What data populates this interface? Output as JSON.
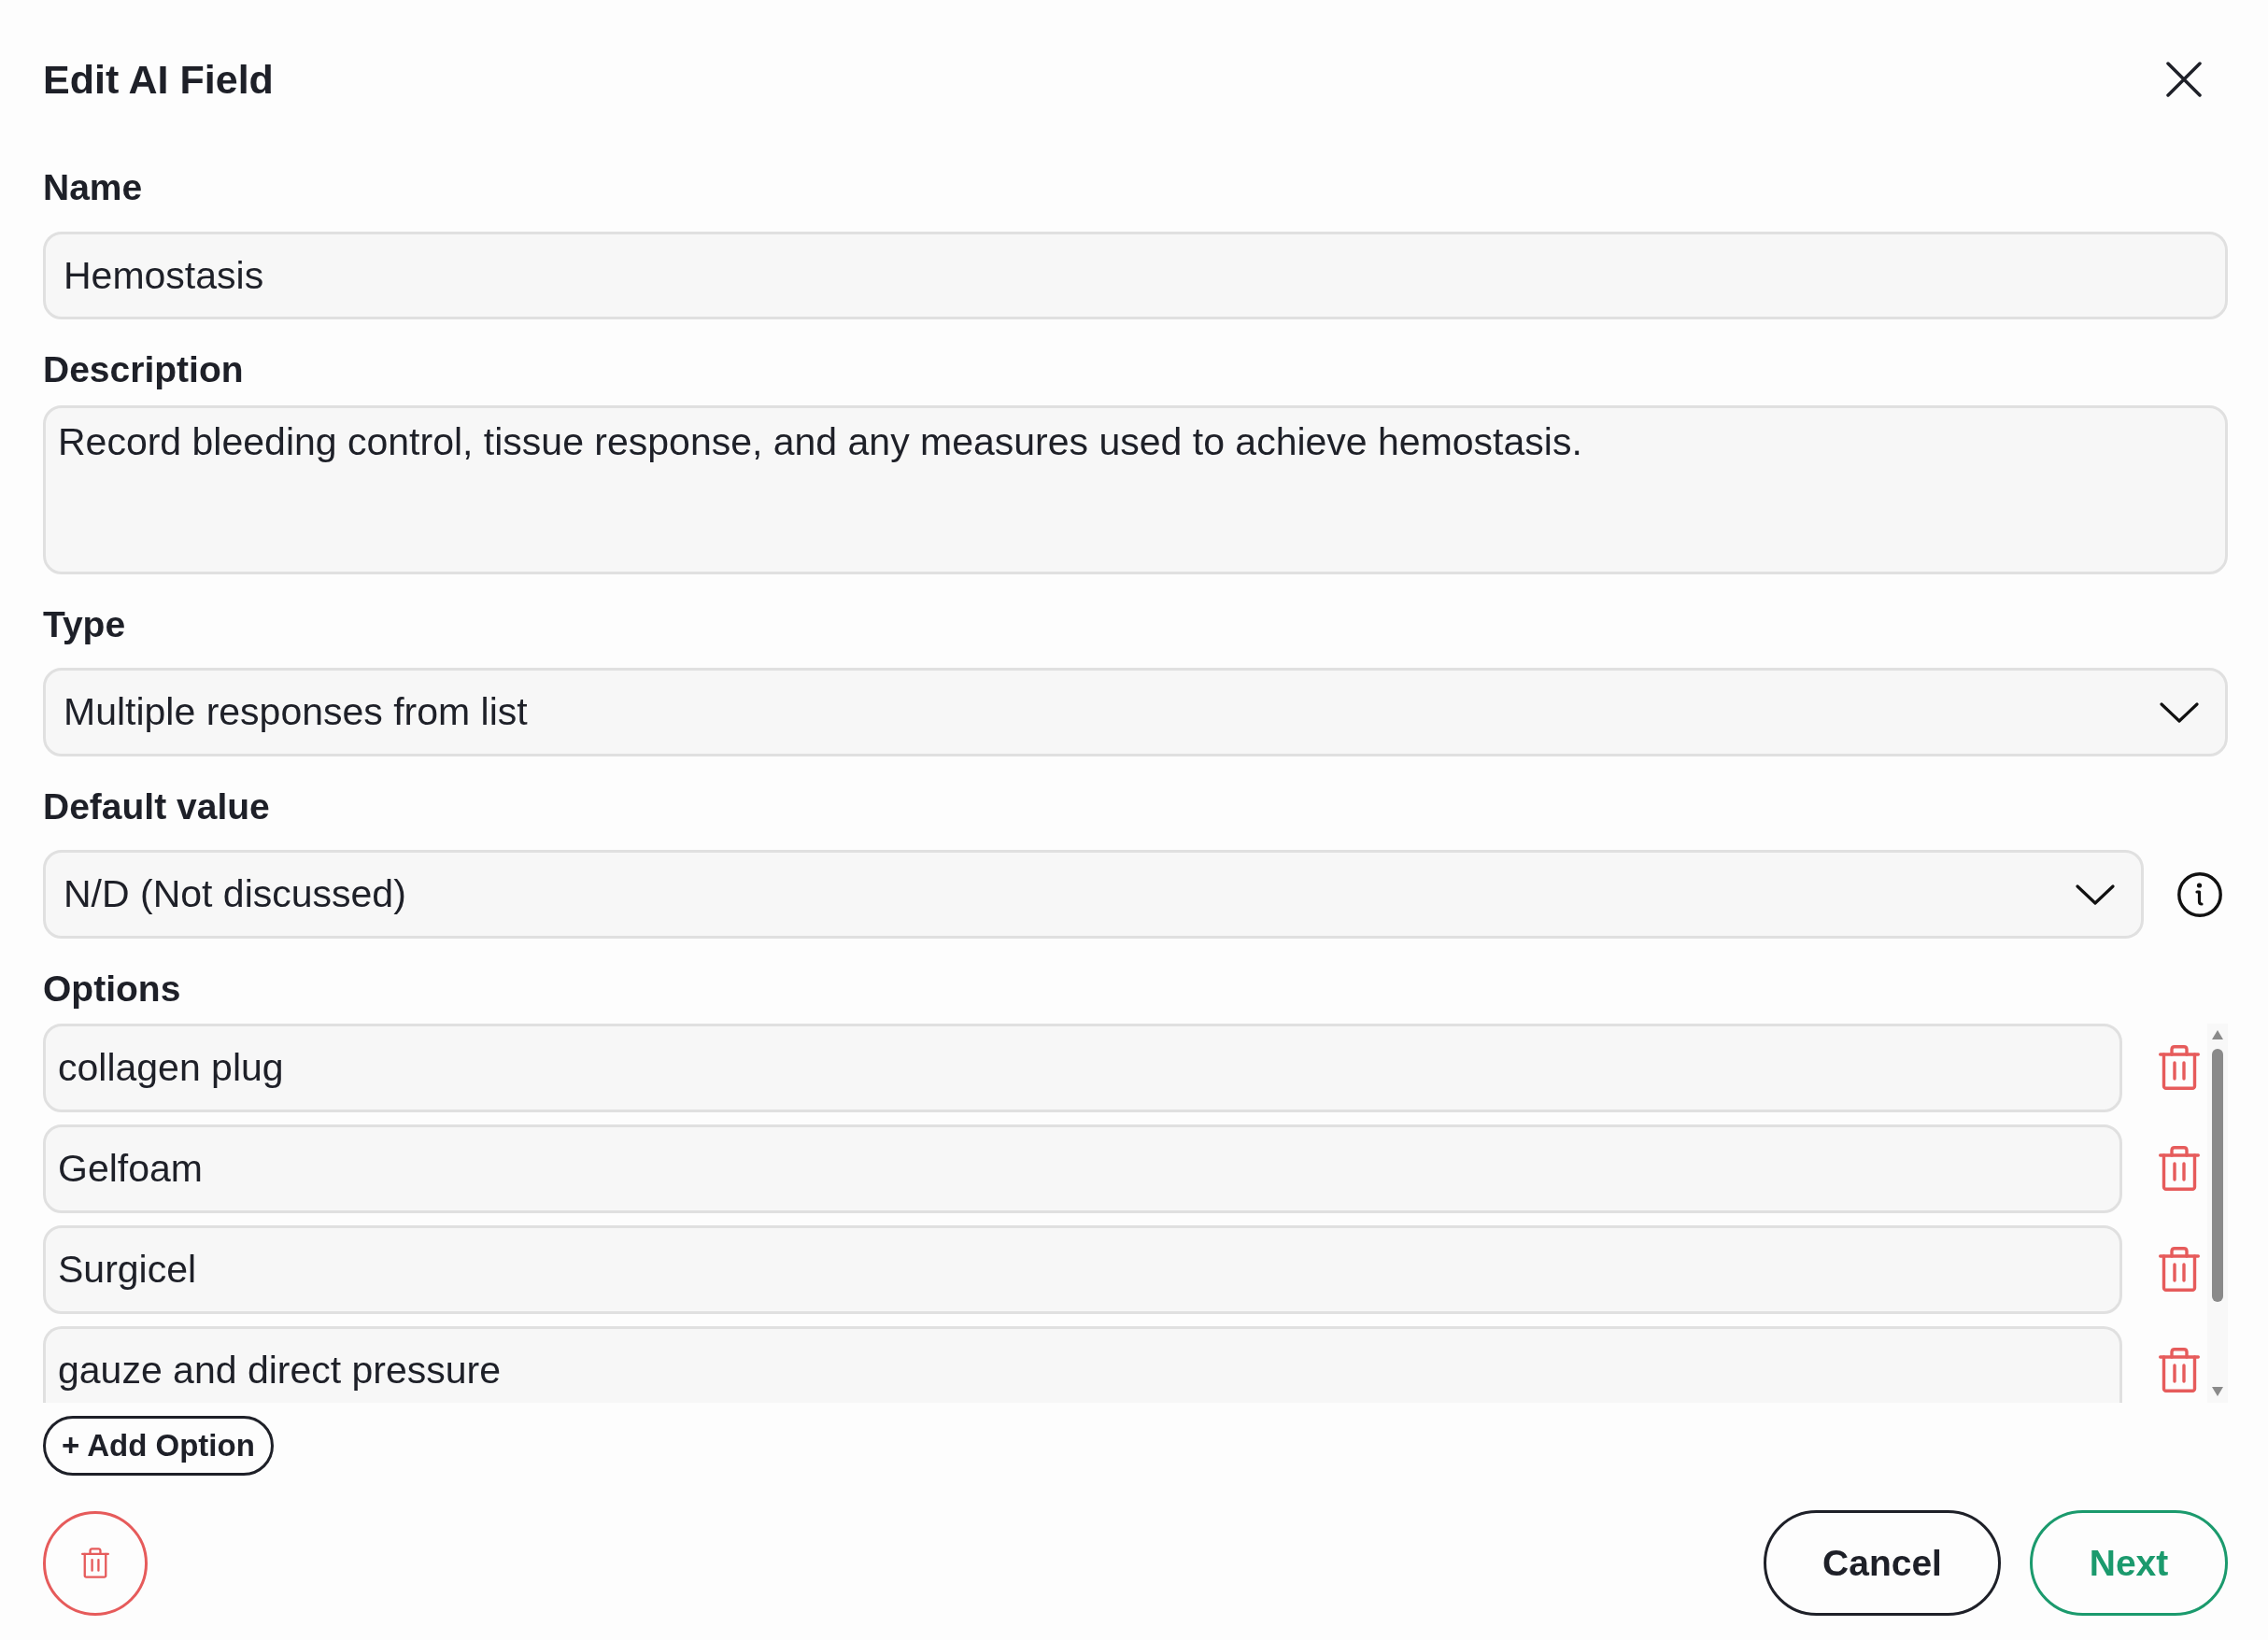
{
  "dialog": {
    "title": "Edit AI Field"
  },
  "fields": [
    {
      "kind": "text",
      "label": "Name",
      "value": "Hemostasis",
      "info": false
    },
    {
      "kind": "textarea",
      "label": "Description",
      "value": "Record bleeding control, tissue response, and any measures used to achieve hemostasis.",
      "info": false
    },
    {
      "kind": "select",
      "label": "Type",
      "value": "Multiple responses from list",
      "info": false
    },
    {
      "kind": "select",
      "label": "Default value",
      "value": "N/D (Not discussed)",
      "info": true
    }
  ],
  "options": {
    "label": "Options",
    "items": [
      "collagen plug",
      "Gelfoam",
      "Surgicel",
      "gauze and direct pressure"
    ],
    "add_button": "+ Add Option"
  },
  "footer": {
    "buttons": [
      {
        "label": "Cancel",
        "kind": "cancel"
      },
      {
        "label": "Next",
        "kind": "confirm"
      }
    ]
  }
}
